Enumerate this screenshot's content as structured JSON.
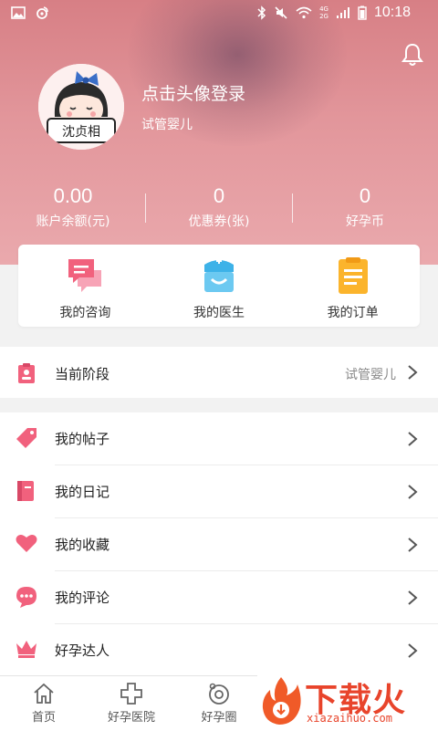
{
  "status_bar": {
    "time": "10:18",
    "net_top": "4G",
    "net_bottom": "2G"
  },
  "profile": {
    "login_prompt": "点击头像登录",
    "stage": "试管婴儿",
    "avatar_caption": "沈贞相"
  },
  "stats": [
    {
      "value": "0.00",
      "label": "账户余额(元)"
    },
    {
      "value": "0",
      "label": "优惠券(张)"
    },
    {
      "value": "0",
      "label": "好孕币"
    }
  ],
  "quick_actions": [
    {
      "label": "我的咨询",
      "icon": "chat-bubble-icon"
    },
    {
      "label": "我的医生",
      "icon": "doctor-icon"
    },
    {
      "label": "我的订单",
      "icon": "order-list-icon"
    }
  ],
  "current_stage": {
    "label": "当前阶段",
    "value": "试管婴儿"
  },
  "menu": [
    {
      "label": "我的帖子",
      "icon": "tag-icon"
    },
    {
      "label": "我的日记",
      "icon": "diary-icon"
    },
    {
      "label": "我的收藏",
      "icon": "heart-icon"
    },
    {
      "label": "我的评论",
      "icon": "comment-icon"
    },
    {
      "label": "好孕达人",
      "icon": "crown-icon"
    }
  ],
  "tabs": [
    {
      "label": "首页",
      "icon": "home-icon"
    },
    {
      "label": "好孕医院",
      "icon": "hospital-cross-icon"
    },
    {
      "label": "好孕圈",
      "icon": "circle-icon"
    }
  ],
  "watermark": {
    "brand": "下载火",
    "url": "xiazaihuo.com"
  },
  "colors": {
    "accent": "#f1617d",
    "header": "#e2969b",
    "watermark": "#e8442b"
  }
}
